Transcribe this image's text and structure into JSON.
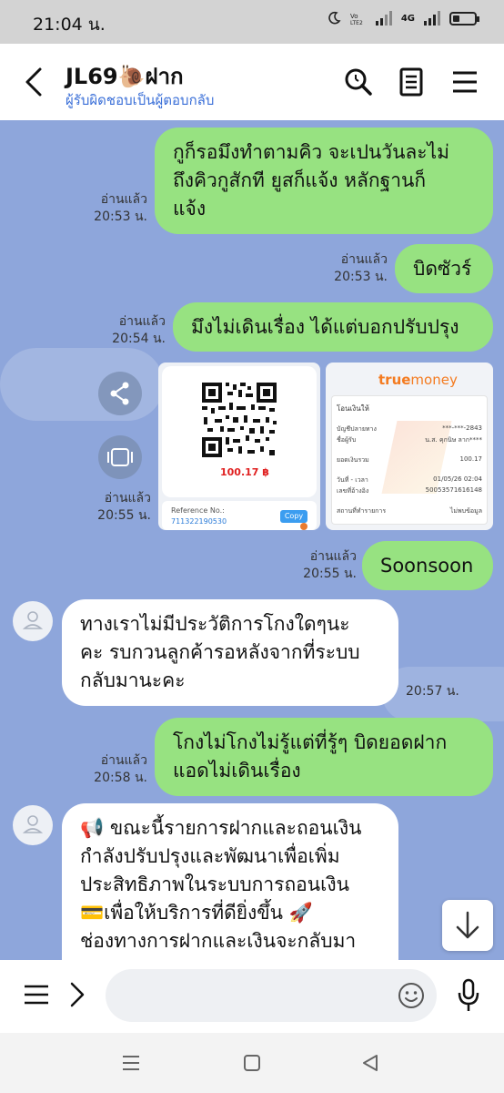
{
  "status_bar": {
    "time": "21:04 น.",
    "network": "4G"
  },
  "header": {
    "title": "JL69🐌ฝาก",
    "subtitle": "ผู้รับผิดชอบเป็นผู้ตอบกลับ"
  },
  "messages": [
    {
      "text_lines": [
        "กูก็รอมึงทำตามคิว จะเปนวันละไม่",
        "ถึงคิวกูสักที ยูสก็แจ้ง หลักฐานก็",
        "แจ้ง"
      ],
      "read": "อ่านแล้ว",
      "time": "20:53 น."
    },
    {
      "text": "บิดซัวร์",
      "read": "อ่านแล้ว",
      "time": "20:53 น."
    },
    {
      "text": "มึงไม่เดินเรื่อง ได้แต่บอกปรับปรุง",
      "read": "อ่านแล้ว",
      "time": "20:54 น."
    },
    {
      "read": "อ่านแล้ว",
      "time": "20:55 น."
    },
    {
      "text": "Soonsoon",
      "read": "อ่านแล้ว",
      "time": "20:55 น."
    },
    {
      "text_lines": [
        "ทางเราไม่มีประวัติการโกงใดๆนะ",
        "คะ รบกวนลูกค้ารอหลังจากที่ระบบ",
        "กลับมานะคะ"
      ],
      "time": "20:57 น."
    },
    {
      "text_lines": [
        "โกงไม่โกงไม่รู้แต่ที่รู้ๆ บิดยอดฝาก",
        "แอดไม่เดินเรื่อง"
      ],
      "read": "อ่านแล้ว",
      "time": "20:58 น."
    },
    {
      "text_lines": [
        "📢 ขณะนี้รายการฝากและถอนเงิน",
        "กำลังปรับปรุงและพัฒนาเพื่อเพิ่ม",
        "ประสิทธิภาพในระบบการถอนเงิน",
        "💳เพื่อให้บริการที่ดียิ่งขึ้น 🚀",
        "ช่องทางการฝากและเงินจะกลับมา"
      ]
    }
  ],
  "qr_image": {
    "amount": "100.17 ฿",
    "reference_label": "Reference No.:",
    "reference_no": "711322190530",
    "copy_label": "Copy"
  },
  "truemoney_image": {
    "brand_true": "true",
    "brand_money": "money",
    "heading": "โอนเงินให้",
    "rows": [
      {
        "label": "บัญชีปลายทาง",
        "value": "***-***-2843"
      },
      {
        "label": "ชื่อผู้รับ",
        "value": "น.ส. คุกนิษ ลาก****"
      },
      {
        "label": "ยอดเงินรวม",
        "value": "100.17"
      },
      {
        "label": "วันที่ - เวลา",
        "value": "01/05/26 02:04"
      },
      {
        "label": "เลขที่อ้างอิง",
        "value": "50053571616148"
      },
      {
        "label": "สถานที่ทำรายการ",
        "value": "ไม่พบข้อมูล"
      }
    ]
  },
  "colors": {
    "chat_bg": "#8ea6db",
    "mine_bubble": "#97e281",
    "theirs_bubble": "#ffffff",
    "subtitle": "#3a6fd8",
    "truemoney_brand": "#f47b20"
  }
}
